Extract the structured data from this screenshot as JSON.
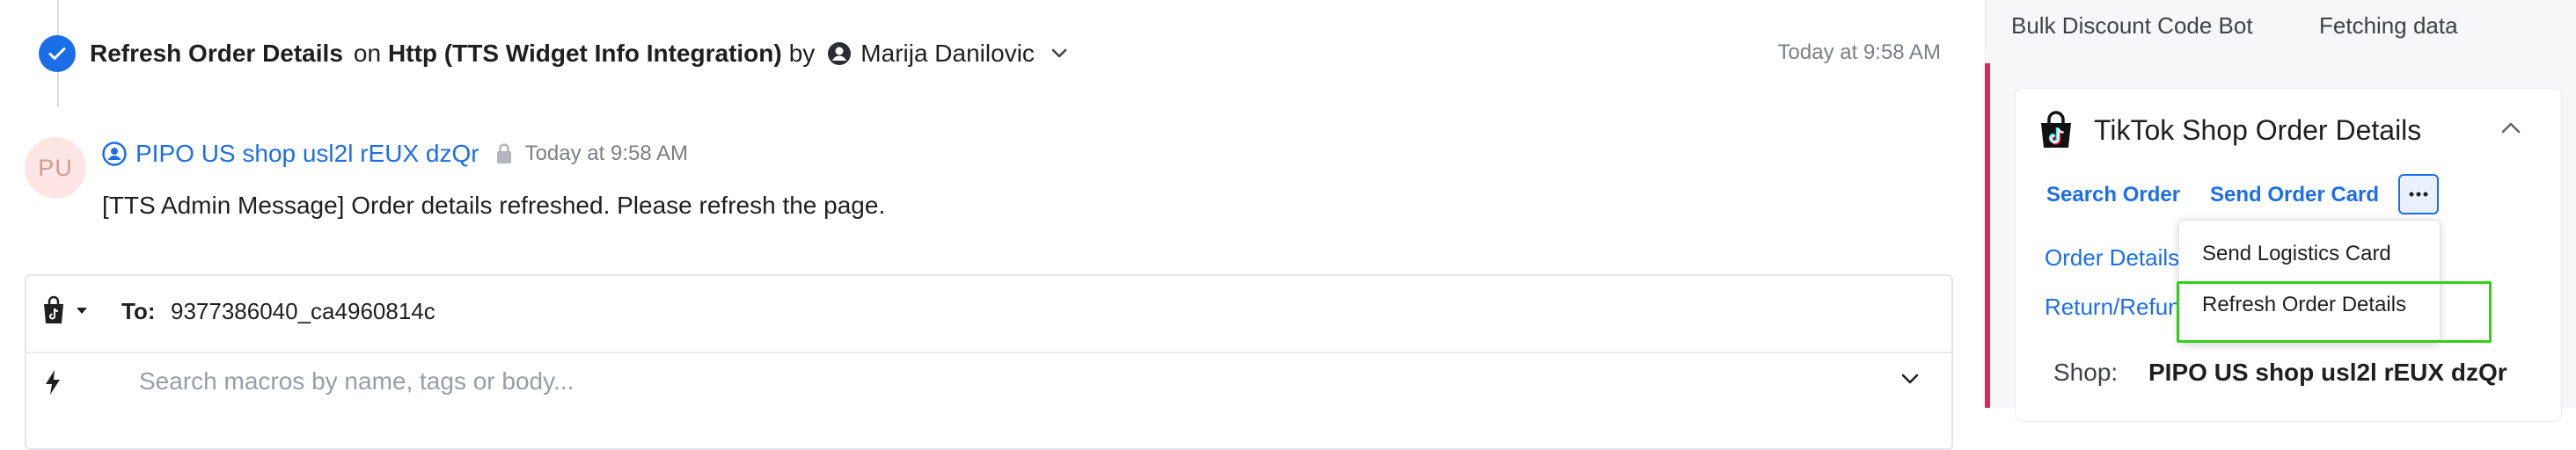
{
  "event": {
    "action": "Refresh Order Details",
    "on_word": "on",
    "integration": "Http (TTS Widget Info Integration)",
    "by_word": "by",
    "user": "Marija Danilovic",
    "time": "Today at 9:58 AM"
  },
  "message": {
    "avatar_initials": "PU",
    "sender": "PIPO US shop usl2l rEUX dzQr",
    "time": "Today at 9:58 AM",
    "body": "[TTS Admin Message] Order details refreshed. Please refresh the page."
  },
  "composer": {
    "to_label": "To:",
    "to_value": "9377386040_ca4960814c",
    "macro_placeholder": "Search macros by name, tags or body..."
  },
  "right_panel": {
    "tabs": [
      "Bulk Discount Code Bot",
      "Fetching data"
    ],
    "card_title": "TikTok Shop Order Details",
    "actions": {
      "search_order": "Search Order",
      "send_order_card": "Send Order Card"
    },
    "sections": {
      "order_details": "Order Details",
      "return_refund": "Return/Refund"
    },
    "shop_label": "Shop:",
    "shop_value": "PIPO US shop usl2l rEUX dzQr",
    "dropdown": [
      "Send Logistics Card",
      "Refresh Order Details"
    ]
  },
  "colors": {
    "accent_blue": "#1c6ee8",
    "panel_accent": "#e0245e",
    "highlight": "#32d017"
  }
}
